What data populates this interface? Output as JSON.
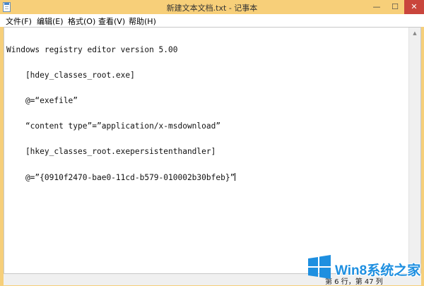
{
  "window": {
    "title": "新建文本文档.txt - 记事本",
    "controls": {
      "minimize": "—",
      "maximize": "☐",
      "close": "✕"
    }
  },
  "menu": {
    "items": [
      "文件(F)",
      "编辑(E)",
      "格式(O)",
      "查看(V)",
      "帮助(H)"
    ]
  },
  "document": {
    "lines": [
      "Windows registry editor version 5.00",
      "    [hdey_classes_root.exe]",
      "    @=“exefile”",
      "    “content type”=”application/x-msdownload”",
      "    [hkey_classes_root.exepersistenthandler]",
      "    @=”{0910f2470-bae0-11cd-b579-010002b30bfeb}”"
    ]
  },
  "status": {
    "position": "第 6 行，第 47 列"
  },
  "watermark": {
    "text": "Win8系统之家",
    "logo_color": "#1e8fe0"
  },
  "icons": {
    "app": "notepad-icon",
    "scroll_up": "scroll-up-arrow-icon",
    "scroll_down": "scroll-down-arrow-icon",
    "logo": "windows-logo-icon"
  }
}
